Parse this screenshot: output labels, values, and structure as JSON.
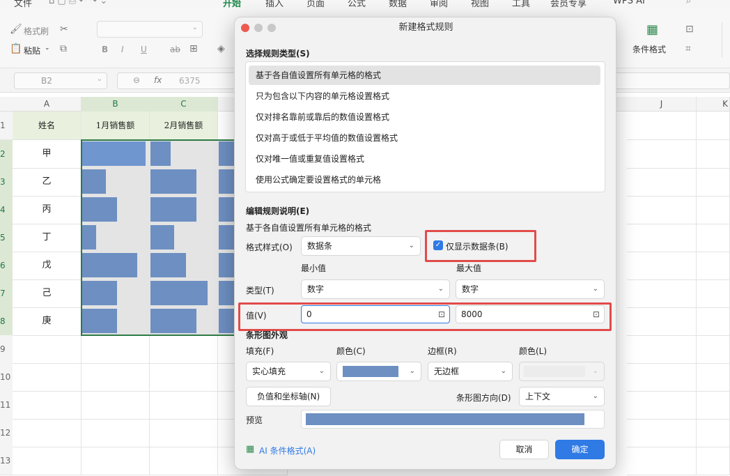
{
  "ribbon": {
    "tabs": [
      "开始",
      "插入",
      "页面",
      "公式",
      "数据",
      "审阅",
      "视图",
      "工具",
      "会员专享",
      "WPS AI"
    ],
    "file": "文件"
  },
  "toolbar": {
    "format_painter": "格式刷",
    "paste": "粘贴",
    "bold": "B",
    "italic": "I",
    "underline": "U",
    "strike": "ab",
    "cond_format": "条件格式"
  },
  "formula": {
    "name_box": "B2",
    "fx": "fx",
    "value": "6375"
  },
  "sheet": {
    "columns": [
      "A",
      "B",
      "C",
      "J",
      "K"
    ],
    "rows": [
      "1",
      "2",
      "3",
      "4",
      "5",
      "6",
      "7",
      "8",
      "9",
      "10",
      "11",
      "12",
      "13"
    ],
    "headers": [
      "姓名",
      "1月销售额",
      "2月销售额"
    ],
    "names": [
      "甲",
      "乙",
      "丙",
      "丁",
      "戊",
      "己",
      "庚"
    ],
    "bars_b": [
      0.95,
      0.35,
      0.52,
      0.21,
      0.82,
      0.52,
      0.52
    ],
    "bars_c": [
      0.3,
      0.69,
      0.69,
      0.35,
      0.53,
      0.85,
      0.69
    ]
  },
  "dialog": {
    "title": "新建格式规则",
    "select_rule_type": "选择规则类型(S)",
    "rules": [
      "基于各自值设置所有单元格的格式",
      "只为包含以下内容的单元格设置格式",
      "仅对排名靠前或靠后的数值设置格式",
      "仅对高于或低于平均值的数值设置格式",
      "仅对唯一值或重复值设置格式",
      "使用公式确定要设置格式的单元格"
    ],
    "edit_rule": "编辑规则说明(E)",
    "rule_desc": "基于各自值设置所有单元格的格式",
    "format_style_label": "格式样式(O)",
    "format_style_value": "数据条",
    "show_bar_only": "仅显示数据条(B)",
    "min_label": "最小值",
    "max_label": "最大值",
    "type_label": "类型(T)",
    "min_type": "数字",
    "max_type": "数字",
    "value_label": "值(V)",
    "min_value": "0",
    "max_value": "8000",
    "bar_appearance": "条形图外观",
    "fill_label": "填充(F)",
    "color_label": "颜色(C)",
    "border_label": "边框(R)",
    "border_color_label": "颜色(L)",
    "fill_value": "实心填充",
    "border_value": "无边框",
    "neg_axis": "负值和坐标轴(N)",
    "bar_dir_label": "条形图方向(D)",
    "bar_dir_value": "上下文",
    "preview_label": "预览",
    "ai_link": "AI 条件格式(A)",
    "cancel": "取消",
    "ok": "确定",
    "bar_color": "#6d8fc2",
    "accent": "#2f7ae5"
  }
}
